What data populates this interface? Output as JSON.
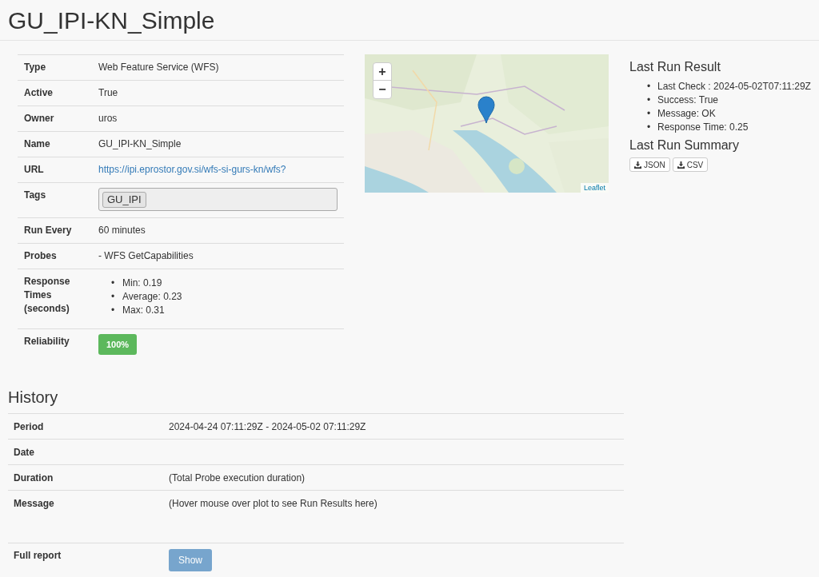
{
  "title": "GU_IPI-KN_Simple",
  "details": [
    {
      "kind": "text",
      "label": "Type",
      "value": "Web Feature Service (WFS)"
    },
    {
      "kind": "text",
      "label": "Active",
      "value": "True"
    },
    {
      "kind": "text",
      "label": "Owner",
      "value": "uros"
    },
    {
      "kind": "text",
      "label": "Name",
      "value": "GU_IPI-KN_Simple"
    },
    {
      "kind": "link",
      "label": "URL",
      "value": "https://ipi.eprostor.gov.si/wfs-si-gurs-kn/wfs?"
    },
    {
      "kind": "tags",
      "label": "Tags",
      "tags": [
        "GU_IPI"
      ]
    },
    {
      "kind": "text",
      "label": "Run Every",
      "value": "60 minutes"
    },
    {
      "kind": "text",
      "label": "Probes",
      "value": "- WFS GetCapabilities"
    },
    {
      "kind": "list",
      "label": "Response Times (seconds)",
      "marker": "•",
      "items": [
        "Min: 0.19",
        "Average: 0.23",
        "Max: 0.31"
      ]
    },
    {
      "kind": "badge",
      "label": "Reliability",
      "value": "100%"
    }
  ],
  "map": {
    "zoom_in": "+",
    "zoom_out": "−",
    "attribution": "Leaflet"
  },
  "last_run_result": {
    "title": "Last Run Result",
    "marker": "•",
    "items": [
      "Last Check : 2024-05-02T07:11:29Z",
      "Success: True",
      "Message: OK",
      "Response Time: 0.25"
    ]
  },
  "last_run_summary": {
    "title": "Last Run Summary",
    "buttons": [
      "JSON",
      "CSV"
    ]
  },
  "history": {
    "title": "History",
    "rows": [
      {
        "label": "Period",
        "value": "2024-04-24 07:11:29Z - 2024-05-02 07:11:29Z"
      },
      {
        "label": "Date"
      },
      {
        "label": "Duration",
        "value": "(Total Probe execution duration)"
      },
      {
        "label": "Message",
        "value": "(Hover mouse over plot to see Run Results here)"
      }
    ],
    "full_report": {
      "label": "Full report",
      "button": "Show",
      "disabled": true
    }
  }
}
